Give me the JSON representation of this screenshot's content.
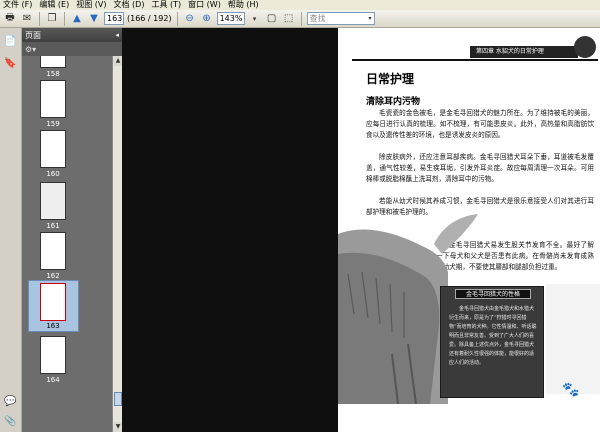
{
  "menu": [
    "文件 (F)",
    "编辑 (E)",
    "视图 (V)",
    "文档 (D)",
    "工具 (T)",
    "窗口 (W)",
    "帮助 (H)"
  ],
  "toolbar": {
    "page_number": "163",
    "page_count": "(166 / 192)",
    "zoom": "143%",
    "search_placeholder": "查找"
  },
  "panel": {
    "title": "页面"
  },
  "thumbnails": [
    {
      "label": "158"
    },
    {
      "label": "159"
    },
    {
      "label": "160"
    },
    {
      "label": "161"
    },
    {
      "label": "162"
    },
    {
      "label": "163"
    },
    {
      "label": "164"
    }
  ],
  "page": {
    "header_banner": "第四章  水貂犬的日常护理",
    "title": "日常护理",
    "subtitle": "清除耳内污物",
    "paragraphs": [
      "毛瓷瓷的金色被毛，是金毛寻回猎犬的魅力所在。为了维持被毛的美丽，应每日进行认真的梳理。如不梳理，有可能患皮炎。此外，高热量和高脂肪饮食以及遗传性差的环境，也是诱发皮炎的原因。",
      "除皮肤病外，还应注意耳部疾病。金毛寻回猎犬耳朵下垂，耳道被毛发覆盖，通气性较差，易生疾耳垢，引发外耳炎症。故应每周清理一次耳朵。可用棉棒或脱脂棉蘸上洗耳剂，清除耳中的污物。",
      "若能从幼犬时候其养成习惯，金毛寻回猎犬是很乐意接受人们对其进行耳部护理和被毛护理的。",
      "金毛寻回猎犬易发生股关节发育不全。最好了解一下母犬和父犬是否患有此病。在骨骼尚未发育成熟的幼犬期，不要使其腰部和腿部负担过重。"
    ],
    "infobox_title": "金毛寻回猎犬的性格",
    "infobox_text": "金毛寻回猎犬由金毛猎犬和水猎犬衍生而来，原是为了“狩猎时寻回猎物”而培育的犬种。它性情温和、听话聪明而且非常友善。受到了广大人们的喜爱。除具备上述优点外，金毛寻回猎犬还有着耐久性很强的体能，能很好的适应人们的活动。"
  },
  "colors": {
    "menubar": "#ece9d8",
    "panel": "#6d6d6d",
    "doc_background": "#6a6a6a",
    "selected_thumb": "#a8c4e0"
  }
}
